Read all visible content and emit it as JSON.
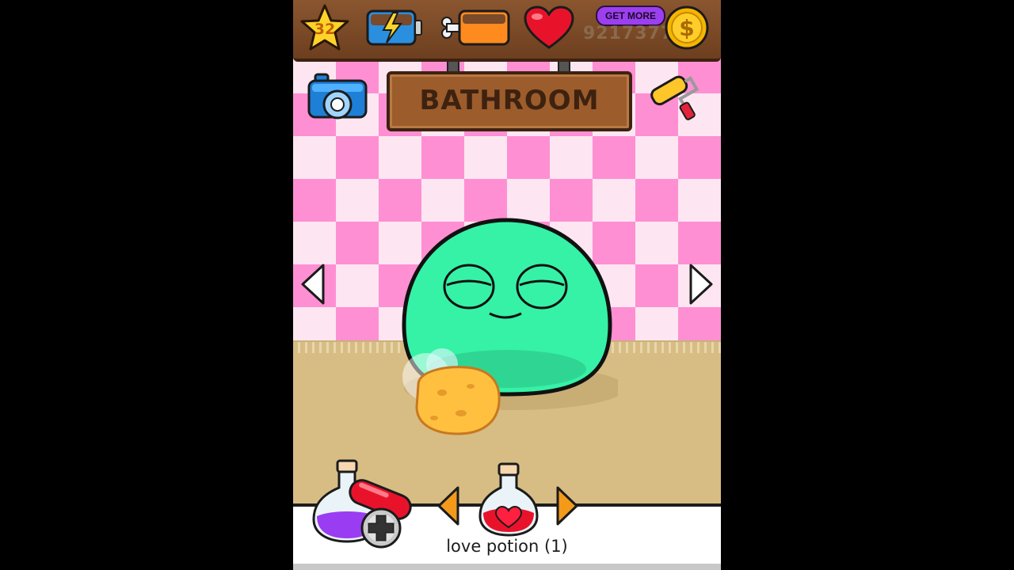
{
  "hud": {
    "level": "32",
    "get_more_label": "GET MORE",
    "coins": "9217377",
    "icons": [
      "level-star-icon",
      "energy-battery-icon",
      "hunger-food-icon",
      "love-heart-icon",
      "coin-icon"
    ]
  },
  "room": {
    "title": "BATHROOM",
    "icons": [
      "camera-icon",
      "paint-roller-icon",
      "arrow-left-icon",
      "arrow-right-icon"
    ]
  },
  "scene": {
    "pet": "green-blob-pet",
    "tool": "sponge-icon"
  },
  "inventory": {
    "selected_item_label": "love potion (1)",
    "icons": [
      "purple-potion-icon",
      "pill-icon",
      "add-icon",
      "love-potion-icon"
    ]
  },
  "colors": {
    "wall_pink": "#ff8fd3",
    "wall_light": "#fde6f1",
    "floor": "#d7bd84",
    "wood": "#9c5c2c",
    "pet_green": "#35f2a7",
    "arrow_orange": "#f39a1b"
  }
}
